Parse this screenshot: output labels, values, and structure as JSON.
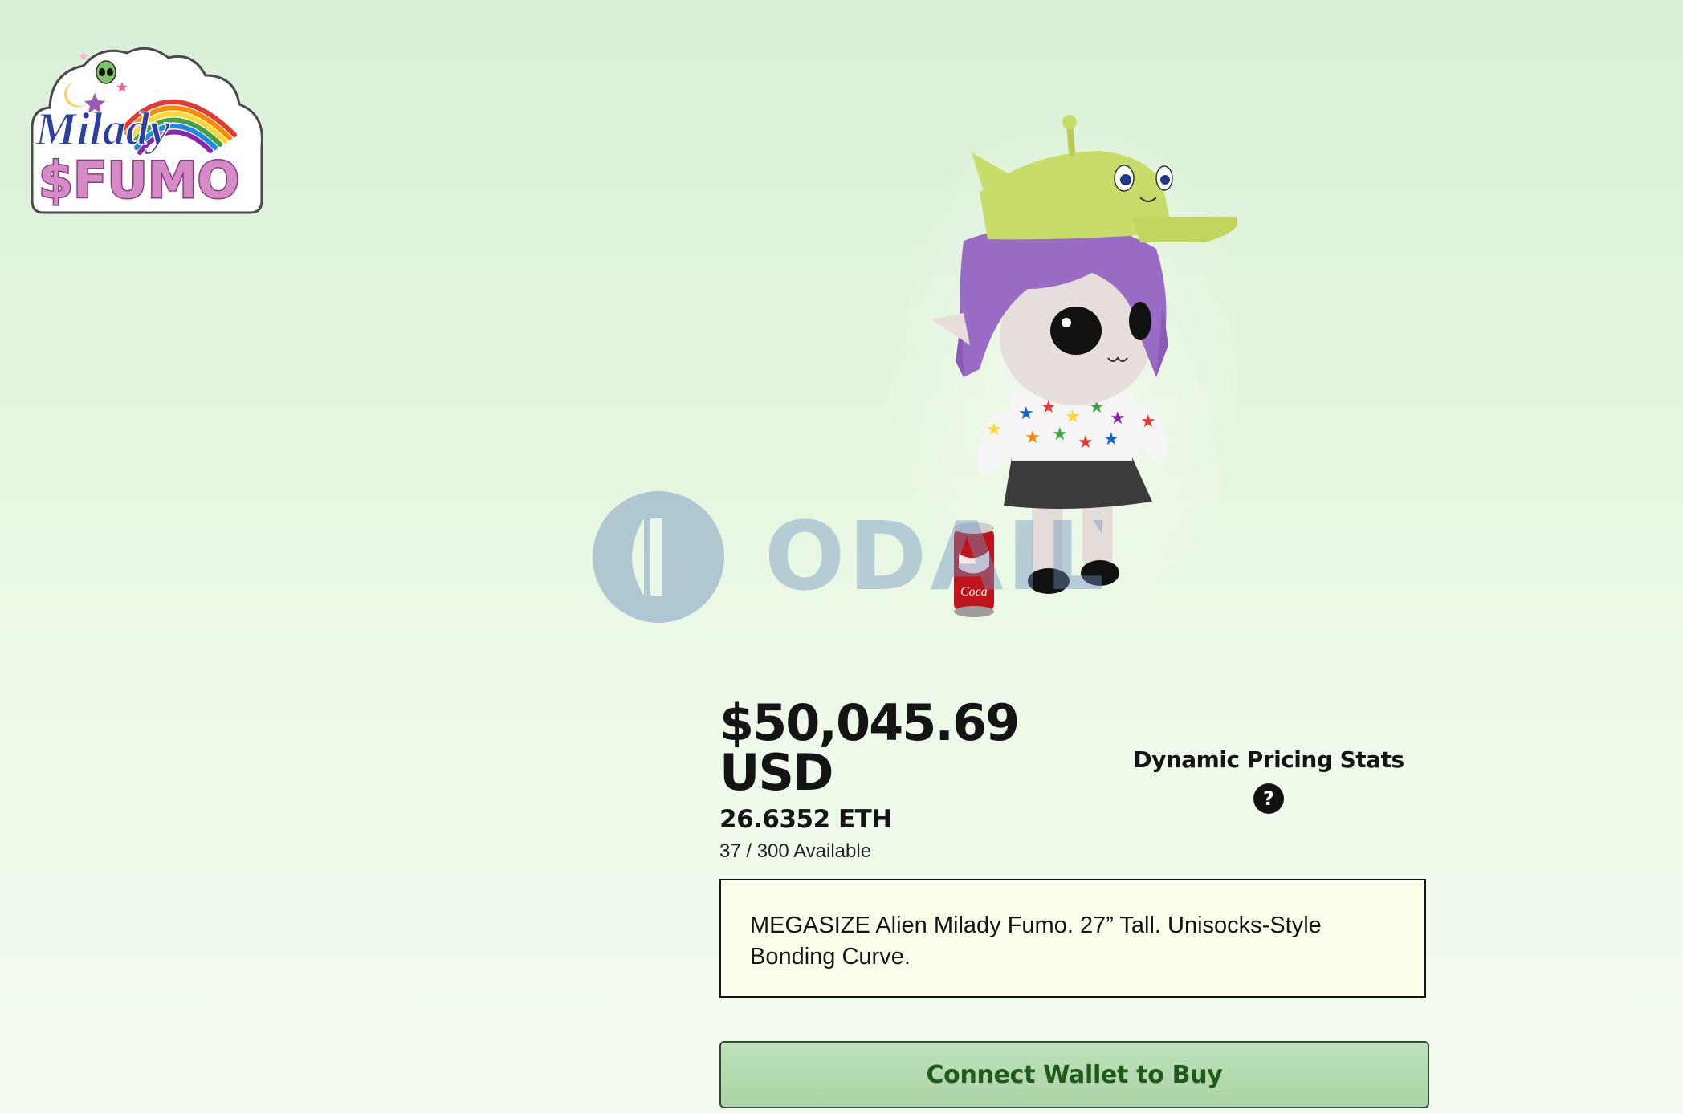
{
  "brand": {
    "logo_line1": "Milady",
    "logo_line2": "$FUMO",
    "logo_icon": "milady-fumo-logo-icon"
  },
  "product": {
    "image_icon": "alien-milady-plush-3d-icon",
    "prop_icon": "soda-can-icon"
  },
  "watermark": {
    "text": "ODAILY",
    "icon": "odaily-logo-icon"
  },
  "pricing": {
    "usd_line1": "$50,045.69",
    "usd_line2": "USD",
    "eth": "26.6352 ETH",
    "availability": "37 / 300 Available"
  },
  "stats": {
    "title": "Dynamic Pricing Stats",
    "help_glyph": "?",
    "help_icon": "question-circle-icon"
  },
  "description": {
    "text": "MEGASIZE Alien Milady Fumo. 27” Tall. Unisocks-Style Bonding Curve."
  },
  "actions": {
    "buy_label": "Connect Wallet to Buy"
  },
  "colors": {
    "background_top": "#d9f0d8",
    "background_bottom": "#f3fbef",
    "button_fill": "#b5d9af",
    "button_text": "#1f5a1a",
    "description_fill": "#fdfdec",
    "logo_pink": "#c978b8",
    "logo_blue": "#2a3f9e"
  }
}
